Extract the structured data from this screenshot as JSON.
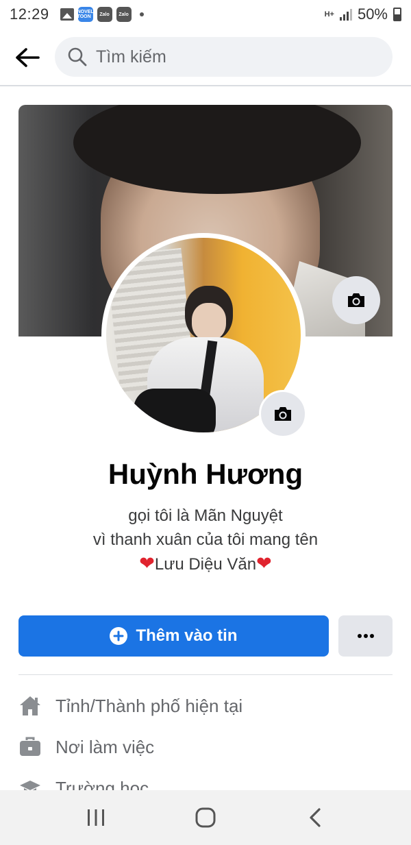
{
  "status_bar": {
    "time": "12:29",
    "apps": [
      "NOVEL TOON",
      "Zalo",
      "Zalo"
    ],
    "network": "H+",
    "battery": "50%"
  },
  "header": {
    "search_placeholder": "Tìm kiếm"
  },
  "profile": {
    "name": "Huỳnh Hương",
    "bio": {
      "line1": "gọi tôi là Mãn Nguyệt",
      "line2": "vì thanh xuân của tôi mang tên",
      "line3_text": "Lưu Diệu Văn",
      "heart": "❤"
    }
  },
  "actions": {
    "add_story_label": "Thêm vào tin",
    "more_label": "···"
  },
  "details": [
    {
      "icon": "home-icon",
      "label": "Tỉnh/Thành phố hiện tại"
    },
    {
      "icon": "briefcase-icon",
      "label": "Nơi làm việc"
    },
    {
      "icon": "graduation-cap-icon",
      "label": "Trường học"
    }
  ],
  "colors": {
    "primary": "#1b74e4",
    "secondary_bg": "#e4e6eb",
    "search_bg": "#f0f2f5",
    "muted_text": "#65676b",
    "heart": "#e0232e"
  }
}
